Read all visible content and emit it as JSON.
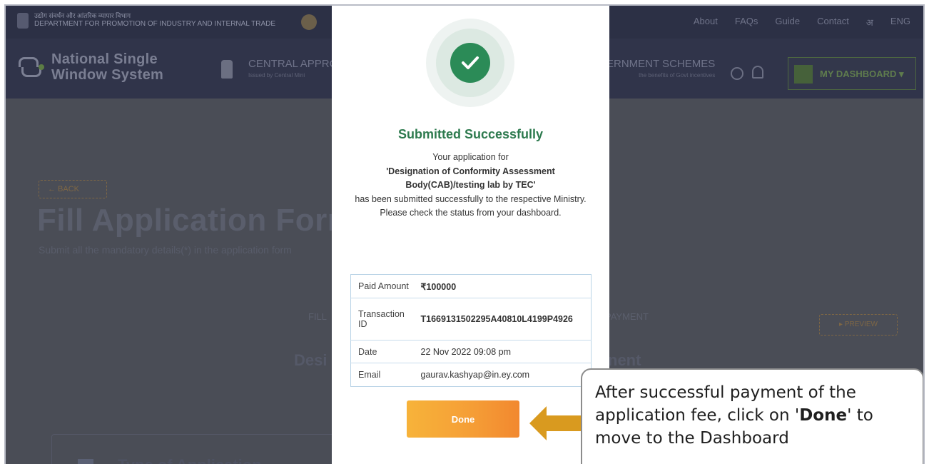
{
  "background": {
    "dept_hindi": "उद्योग संवर्धन और आंतरिक व्यापार विभाग",
    "dept_english": "DEPARTMENT FOR PROMOTION OF INDUSTRY AND INTERNAL TRADE",
    "top_links": [
      "About",
      "FAQs",
      "Guide",
      "Contact",
      "अ",
      "ENG"
    ],
    "brand_line1": "National Single",
    "brand_line2": "Window System",
    "central_label": "CENTRAL APPRO",
    "central_sub": "Issued by Central Mini",
    "govt_label": "ERNMENT SCHEMES",
    "govt_sub": "the benefits of Govt incentives",
    "dashboard_label": "MY DASHBOARD ▾",
    "back_label": "← BACK",
    "page_title": "Fill Application Form",
    "page_subtitle": "Submit all the mandatory details(*) in the application form",
    "step_fill": "FILL",
    "step_payment": "PAYMENT",
    "preview_label": "▸ PREVIEW",
    "section_title_left": "Desi",
    "section_title_right": "nent",
    "card_title": "Type of Application"
  },
  "modal": {
    "title": "Submitted Successfully",
    "message_line1": "Your application for",
    "app_name": "'Designation of Conformity Assessment Body(CAB)/testing lab by TEC'",
    "message_line2": "has been submitted successfully to the respective Ministry. Please check the status from your dashboard.",
    "rows": [
      {
        "label": "Paid Amount",
        "value": "₹100000",
        "bold": true
      },
      {
        "label": "Transaction ID",
        "value": "T1669131502295A40810L4199P4926",
        "bold": true
      },
      {
        "label": "Date",
        "value": "22 Nov 2022 09:08 pm",
        "bold": false
      },
      {
        "label": "Email",
        "value": "gaurav.kashyap@in.ey.com",
        "bold": false
      }
    ],
    "done_label": "Done"
  },
  "callout": {
    "text_before": "After successful payment of the application fee, click on '",
    "text_bold": "Done",
    "text_after": "' to move to the Dashboard"
  },
  "colors": {
    "success_green": "#2b8b57",
    "done_orange": "#f59d36",
    "arrow_gold": "#d99a1f"
  }
}
